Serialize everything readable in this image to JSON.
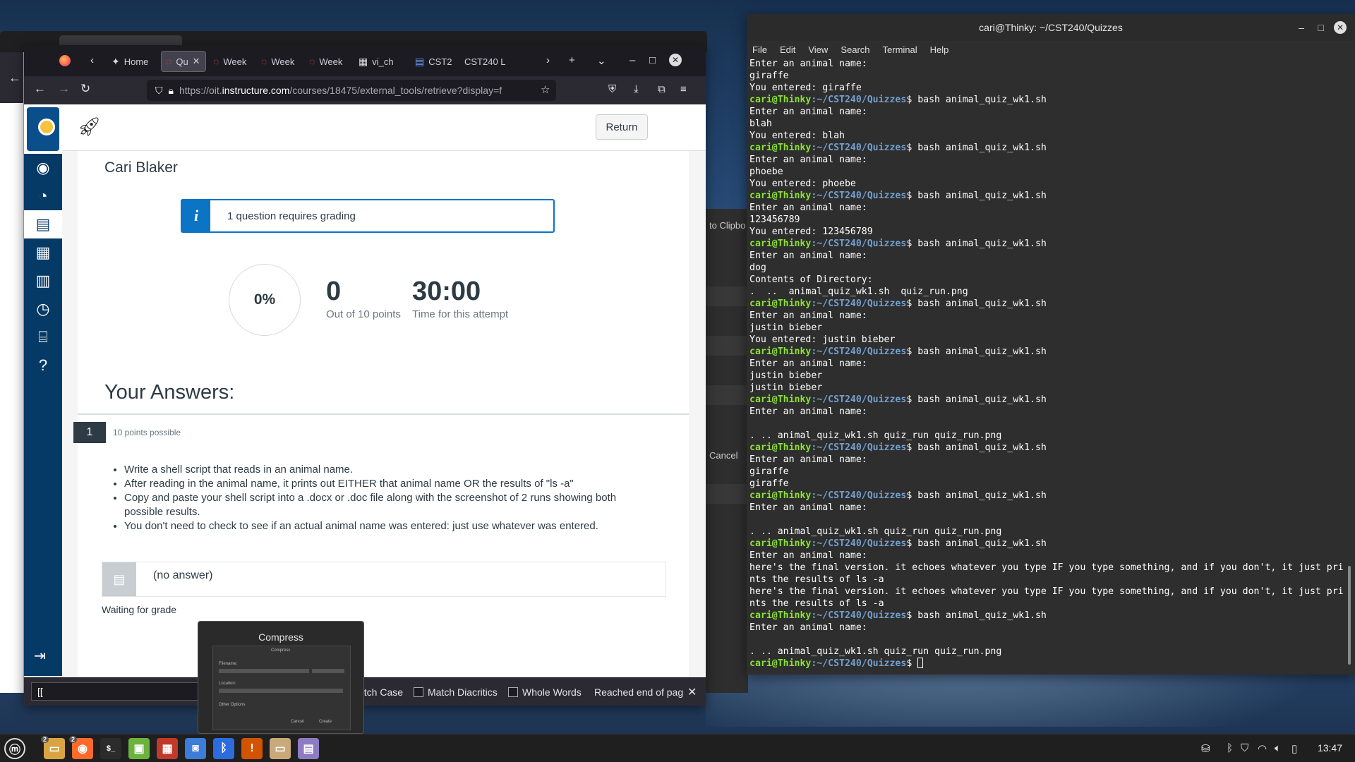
{
  "firefox": {
    "tabs": [
      {
        "label": "Home",
        "icon": "canvas-icon"
      },
      {
        "label": "Qu",
        "icon": "quiz-icon",
        "active": true
      },
      {
        "label": "Week",
        "icon": "quiz-icon"
      },
      {
        "label": "Week",
        "icon": "quiz-icon"
      },
      {
        "label": "Week",
        "icon": "quiz-icon"
      },
      {
        "label": "vi_ch",
        "icon": "vim-icon"
      },
      {
        "label": "CST2",
        "icon": "doc-icon"
      },
      {
        "label": "CST240 L",
        "icon": ""
      }
    ],
    "url_host": "https://oit.",
    "url_domain": "instructure.com",
    "url_path": "/courses/18475/external_tools/retrieve?display=f",
    "find_value": "[[",
    "find_options": [
      "atch Case",
      "Match Diacritics",
      "Whole Words"
    ],
    "find_status": "Reached end of pag"
  },
  "canvas": {
    "return_label": "Return",
    "student_name": "Cari Blaker",
    "alert_icon": "i",
    "alert_text": "1 question requires grading",
    "score_percent": "0%",
    "points": "0",
    "points_label": "Out of 10 points",
    "time": "30:00",
    "time_label": "Time for this attempt",
    "answers_heading": "Your Answers:",
    "question_number": "1",
    "points_possible": "10 points possible",
    "question_items": [
      "Write a shell script that reads in an animal name.",
      "After reading in the animal name, it prints out EITHER that animal name OR the results of \"ls -a\"",
      "Copy and paste your shell script into a .docx or .doc file along with the screenshot of 2 runs showing both possible results.",
      "You don't need to check to see if an actual animal name was entered: just use whatever was entered."
    ],
    "no_answer": "(no answer)",
    "waiting": "Waiting for grade"
  },
  "compress": {
    "title": "Compress",
    "inner_title": "Compress",
    "filename_label": "Filename:",
    "location_label": "Location:",
    "other_options": "Other Options",
    "cancel": "Cancel",
    "create": "Create"
  },
  "background_dialog": {
    "clipboard_text": "to Clipbo",
    "cancel_text": "Cancel"
  },
  "terminal": {
    "title": "cari@Thinky: ~/CST240/Quizzes",
    "menu": [
      "File",
      "Edit",
      "View",
      "Search",
      "Terminal",
      "Help"
    ],
    "prompt_user": "cari@Thinky",
    "prompt_path": ":~/CST240/Quizzes",
    "lines": [
      {
        "t": "Enter an animal name:"
      },
      {
        "t": "giraffe"
      },
      {
        "t": "You entered: giraffe"
      },
      {
        "p": "bash animal_quiz_wk1.sh"
      },
      {
        "t": "Enter an animal name:"
      },
      {
        "t": "blah"
      },
      {
        "t": "You entered: blah"
      },
      {
        "p": "bash animal_quiz_wk1.sh"
      },
      {
        "t": "Enter an animal name:"
      },
      {
        "t": "phoebe"
      },
      {
        "t": "You entered: phoebe"
      },
      {
        "p": "bash animal_quiz_wk1.sh"
      },
      {
        "t": "Enter an animal name:"
      },
      {
        "t": "123456789"
      },
      {
        "t": "You entered: 123456789"
      },
      {
        "p": "bash animal_quiz_wk1.sh"
      },
      {
        "t": "Enter an animal name:"
      },
      {
        "t": "dog"
      },
      {
        "t": "Contents of Directory:"
      },
      {
        "t": ".  ..  animal_quiz_wk1.sh  quiz_run.png"
      },
      {
        "p": "bash animal_quiz_wk1.sh"
      },
      {
        "t": "Enter an animal name:"
      },
      {
        "t": "justin bieber"
      },
      {
        "t": "You entered: justin bieber"
      },
      {
        "p": "bash animal_quiz_wk1.sh"
      },
      {
        "t": "Enter an animal name:"
      },
      {
        "t": "justin bieber"
      },
      {
        "t": "justin bieber"
      },
      {
        "p": "bash animal_quiz_wk1.sh"
      },
      {
        "t": "Enter an animal name:"
      },
      {
        "t": ""
      },
      {
        "t": ". .. animal_quiz_wk1.sh quiz_run quiz_run.png"
      },
      {
        "p": "bash animal_quiz_wk1.sh"
      },
      {
        "t": "Enter an animal name:"
      },
      {
        "t": "giraffe"
      },
      {
        "t": "giraffe"
      },
      {
        "p": "bash animal_quiz_wk1.sh"
      },
      {
        "t": "Enter an animal name:"
      },
      {
        "t": ""
      },
      {
        "t": ". .. animal_quiz_wk1.sh quiz_run quiz_run.png"
      },
      {
        "p": "bash animal_quiz_wk1.sh"
      },
      {
        "t": "Enter an animal name:"
      },
      {
        "t": "here's the final version. it echoes whatever you type IF you type something, and if you don't, it just pri"
      },
      {
        "t": "nts the results of ls -a"
      },
      {
        "t": "here's the final version. it echoes whatever you type IF you type something, and if you don't, it just pri"
      },
      {
        "t": "nts the results of ls -a"
      },
      {
        "p": "bash animal_quiz_wk1.sh"
      },
      {
        "t": "Enter an animal name:"
      },
      {
        "t": ""
      },
      {
        "t": ". .. animal_quiz_wk1.sh quiz_run quiz_run.png"
      },
      {
        "p": "",
        "cursor": true
      }
    ]
  },
  "taskbar": {
    "apps": [
      {
        "icon": "mint-menu-icon"
      },
      {
        "icon": "files-icon",
        "badge": "2"
      },
      {
        "icon": "firefox-icon",
        "badge": "2"
      },
      {
        "icon": "terminal-icon",
        "label": "$_"
      },
      {
        "icon": "software-manager-icon"
      },
      {
        "icon": "firewall-icon"
      },
      {
        "icon": "screenshot-icon"
      },
      {
        "icon": "bluetooth-icon"
      },
      {
        "icon": "update-manager-icon"
      },
      {
        "icon": "archive-manager-icon"
      },
      {
        "icon": "text-editor-icon"
      }
    ],
    "clock": "13:47"
  }
}
